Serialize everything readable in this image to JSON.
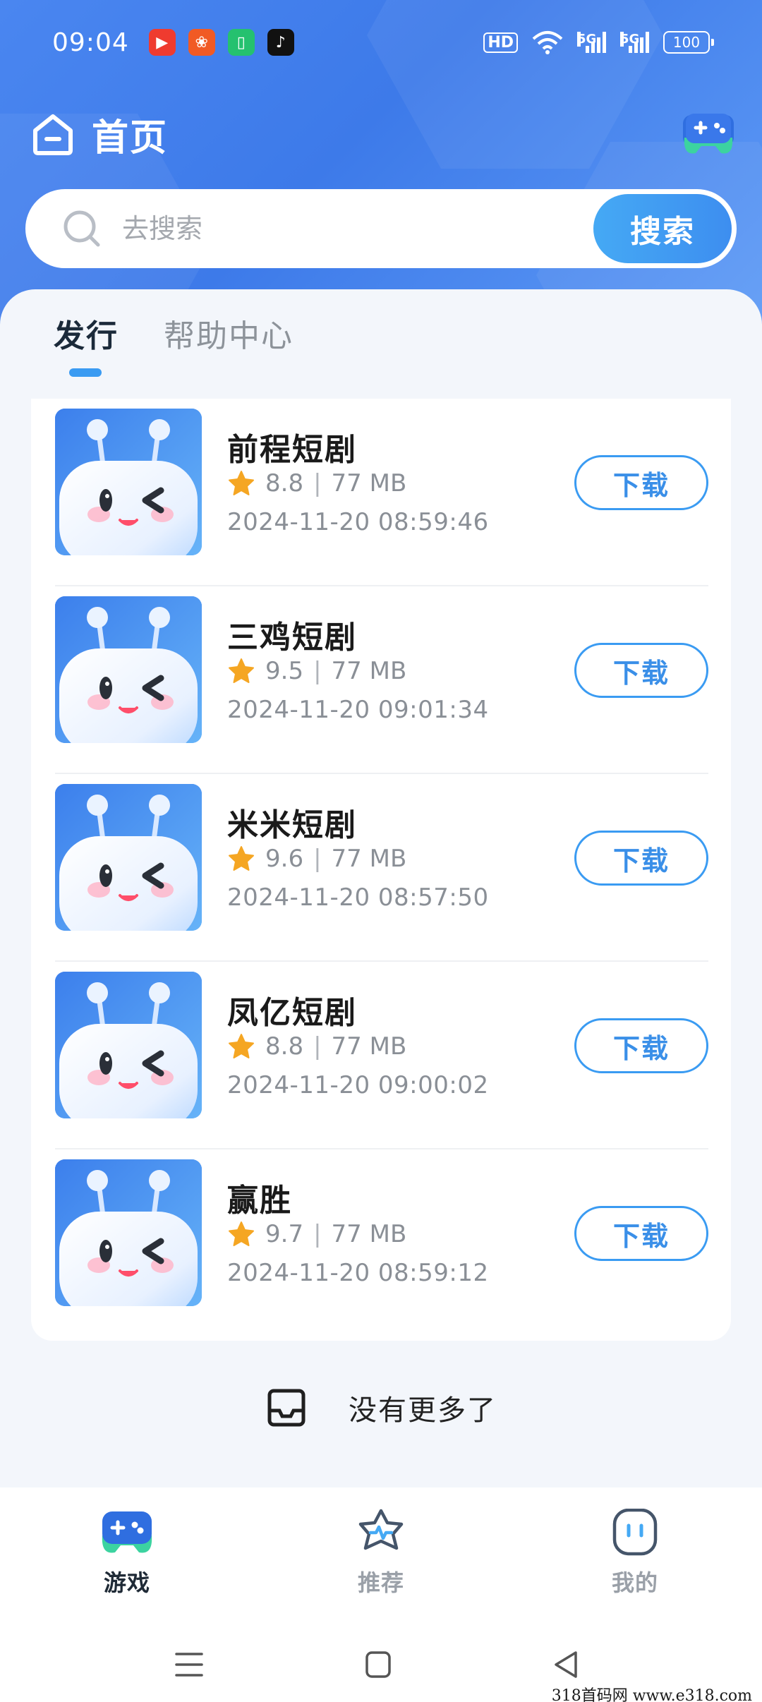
{
  "status_bar": {
    "time": "09:04",
    "hd_label": "HD",
    "net1": "5G",
    "net2": "5G",
    "battery": "100"
  },
  "header": {
    "title": "首页"
  },
  "search": {
    "placeholder": "去搜索",
    "button_label": "搜索"
  },
  "tabs": [
    {
      "label": "发行",
      "active": true
    },
    {
      "label": "帮助中心",
      "active": false
    }
  ],
  "apps": [
    {
      "name": "前程短剧",
      "rating": "8.8",
      "size": "77 MB",
      "date": "2024-11-20 08:59:46",
      "button": "下载"
    },
    {
      "name": "三鸡短剧",
      "rating": "9.5",
      "size": "77 MB",
      "date": "2024-11-20 09:01:34",
      "button": "下载"
    },
    {
      "name": "米米短剧",
      "rating": "9.6",
      "size": "77 MB",
      "date": "2024-11-20 08:57:50",
      "button": "下载"
    },
    {
      "name": "凤亿短剧",
      "rating": "8.8",
      "size": "77 MB",
      "date": "2024-11-20 09:00:02",
      "button": "下载"
    },
    {
      "name": "赢胜",
      "rating": "9.7",
      "size": "77 MB",
      "date": "2024-11-20 08:59:12",
      "button": "下载"
    }
  ],
  "meta_separator": "|",
  "list_footer": "没有更多了",
  "bottom_nav": [
    {
      "label": "游戏",
      "icon": "gamepad-icon",
      "active": true
    },
    {
      "label": "推荐",
      "icon": "star-badge-icon",
      "active": false
    },
    {
      "label": "我的",
      "icon": "face-icon",
      "active": false
    }
  ],
  "watermark": "318首码网  www.e318.com",
  "colors": {
    "header_blue": "#3d7ae9",
    "accent_blue": "#3a9bf2",
    "star_orange": "#f5a623"
  }
}
